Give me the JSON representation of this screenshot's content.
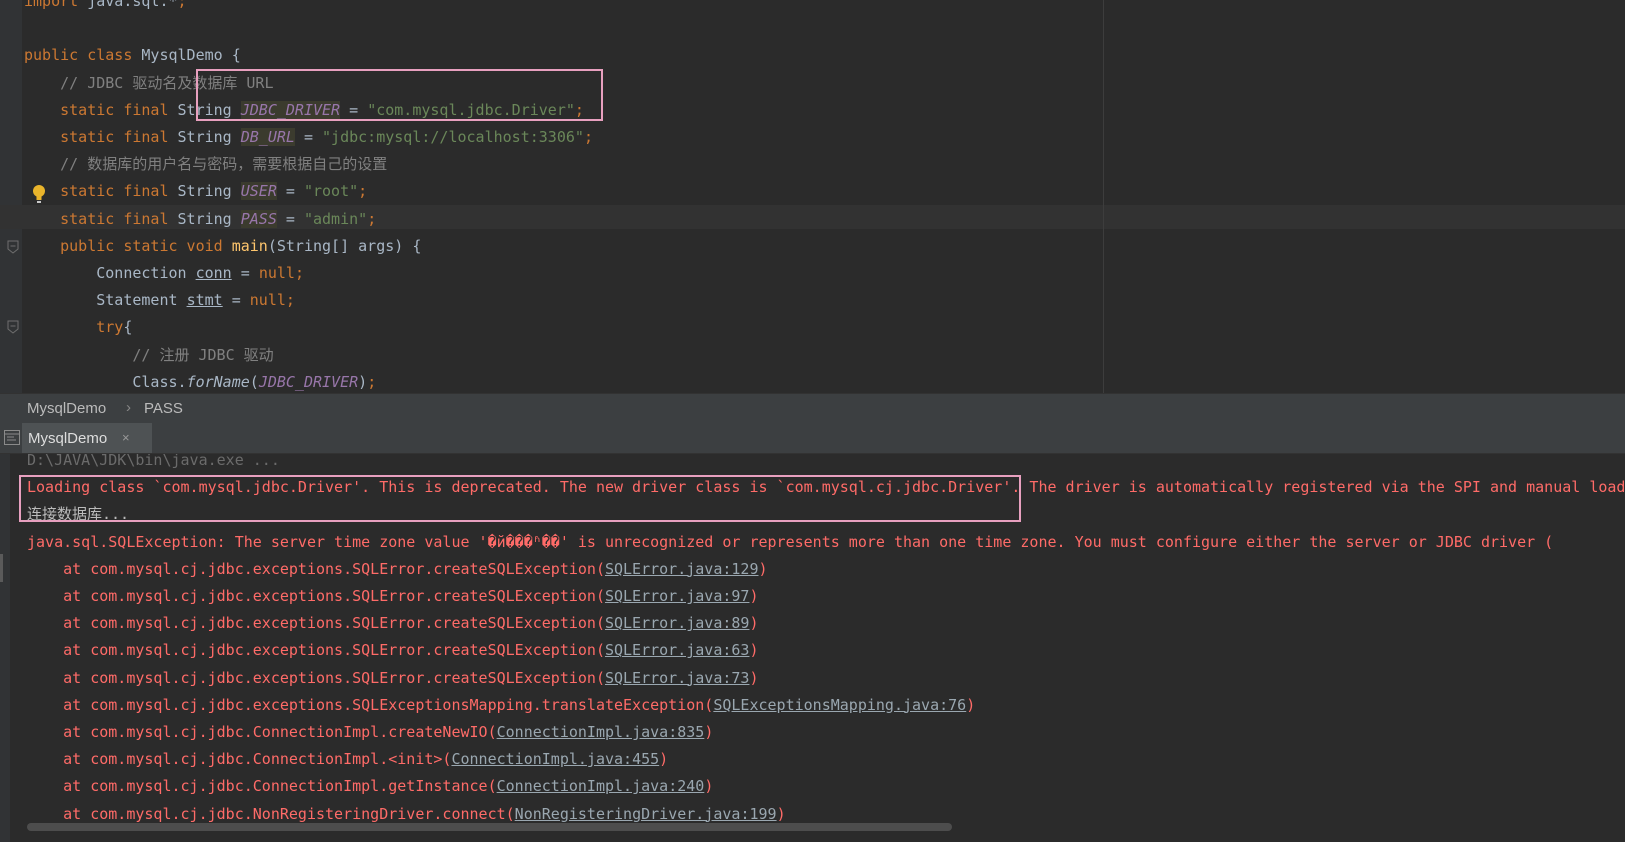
{
  "editor": {
    "lines": [
      {
        "segments": [
          {
            "t": "import ",
            "c": "kw"
          },
          {
            "t": "java.sql.*",
            "c": ""
          },
          {
            "t": ";",
            "c": "kw"
          }
        ]
      },
      {
        "segments": [
          {
            "t": "",
            "c": ""
          }
        ]
      },
      {
        "segments": [
          {
            "t": "public class ",
            "c": "kw"
          },
          {
            "t": "MysqlDemo {",
            "c": ""
          }
        ]
      },
      {
        "segments": [
          {
            "t": "    // JDBC 驱动名及数据库 URL",
            "c": "cm"
          }
        ]
      },
      {
        "segments": [
          {
            "t": "    static final ",
            "c": "kw"
          },
          {
            "t": "String ",
            "c": ""
          },
          {
            "t": "JDBC_DRIVER",
            "c": "cst hl"
          },
          {
            "t": " = ",
            "c": ""
          },
          {
            "t": "\"com.mysql.jdbc.Driver\"",
            "c": "str"
          },
          {
            "t": ";",
            "c": "kw"
          }
        ]
      },
      {
        "segments": [
          {
            "t": "    static final ",
            "c": "kw"
          },
          {
            "t": "String ",
            "c": ""
          },
          {
            "t": "DB_URL",
            "c": "cst hl"
          },
          {
            "t": " = ",
            "c": ""
          },
          {
            "t": "\"jdbc:mysql://localhost:3306\"",
            "c": "str"
          },
          {
            "t": ";",
            "c": "kw"
          }
        ]
      },
      {
        "segments": [
          {
            "t": "    // 数据库的用户名与密码，需要根据自己的设置",
            "c": "cm"
          }
        ]
      },
      {
        "segments": [
          {
            "t": "    static final ",
            "c": "kw"
          },
          {
            "t": "String ",
            "c": ""
          },
          {
            "t": "USER",
            "c": "cst hl"
          },
          {
            "t": " = ",
            "c": ""
          },
          {
            "t": "\"root\"",
            "c": "str"
          },
          {
            "t": ";",
            "c": "kw"
          }
        ]
      },
      {
        "segments": [
          {
            "t": "    static final ",
            "c": "kw"
          },
          {
            "t": "String ",
            "c": ""
          },
          {
            "t": "PASS",
            "c": "cst hl"
          },
          {
            "t": " = ",
            "c": ""
          },
          {
            "t": "\"admin\"",
            "c": "str"
          },
          {
            "t": ";",
            "c": "kw"
          }
        ]
      },
      {
        "segments": [
          {
            "t": "    public static void ",
            "c": "kw"
          },
          {
            "t": "main",
            "c": "fn"
          },
          {
            "t": "(String[] args) {",
            "c": ""
          }
        ]
      },
      {
        "segments": [
          {
            "t": "        Connection ",
            "c": ""
          },
          {
            "t": "conn",
            "c": "ul"
          },
          {
            "t": " = ",
            "c": ""
          },
          {
            "t": "null",
            "c": "kw"
          },
          {
            "t": ";",
            "c": "kw"
          }
        ]
      },
      {
        "segments": [
          {
            "t": "        Statement ",
            "c": ""
          },
          {
            "t": "stmt",
            "c": "ul"
          },
          {
            "t": " = ",
            "c": ""
          },
          {
            "t": "null",
            "c": "kw"
          },
          {
            "t": ";",
            "c": "kw"
          }
        ]
      },
      {
        "segments": [
          {
            "t": "        try",
            "c": "kw"
          },
          {
            "t": "{",
            "c": ""
          }
        ]
      },
      {
        "segments": [
          {
            "t": "            // 注册 JDBC 驱动",
            "c": "cm"
          }
        ]
      },
      {
        "segments": [
          {
            "t": "            Class.",
            "c": ""
          },
          {
            "t": "forName",
            "c": "it"
          },
          {
            "t": "(",
            "c": ""
          },
          {
            "t": "JDBC_DRIVER",
            "c": "cst"
          },
          {
            "t": ")",
            "c": ""
          },
          {
            "t": ";",
            "c": "kw"
          }
        ]
      }
    ]
  },
  "breadcrumb": {
    "items": [
      "MysqlDemo",
      "PASS"
    ],
    "separator": "›"
  },
  "run_tab": {
    "label": "MysqlDemo",
    "close": "×"
  },
  "console": {
    "lines": [
      {
        "segments": [
          {
            "t": "D:\\JAVA\\JDK\\bin\\java.exe ...",
            "c": "dim"
          }
        ]
      },
      {
        "segments": [
          {
            "t": "Loading class `com.mysql.jdbc.Driver'. This is deprecated. The new driver class is `com.mysql.cj.jdbc.Driver'. The driver is automatically registered via the SPI and manual loading",
            "c": "err"
          }
        ]
      },
      {
        "segments": [
          {
            "t": "连接数据库...",
            "c": "norm"
          }
        ]
      },
      {
        "segments": [
          {
            "t": "java.sql.SQLException: The server time zone value '�й���ʱ��' is unrecognized or represents more than one time zone. You must configure either the server or JDBC driver (",
            "c": "err"
          }
        ]
      },
      {
        "segments": [
          {
            "t": "    at com.mysql.cj.jdbc.exceptions.SQLError.createSQLException(",
            "c": "err"
          },
          {
            "t": "SQLError.java:129",
            "c": "link"
          },
          {
            "t": ")",
            "c": "err"
          }
        ]
      },
      {
        "segments": [
          {
            "t": "    at com.mysql.cj.jdbc.exceptions.SQLError.createSQLException(",
            "c": "err"
          },
          {
            "t": "SQLError.java:97",
            "c": "link"
          },
          {
            "t": ")",
            "c": "err"
          }
        ]
      },
      {
        "segments": [
          {
            "t": "    at com.mysql.cj.jdbc.exceptions.SQLError.createSQLException(",
            "c": "err"
          },
          {
            "t": "SQLError.java:89",
            "c": "link"
          },
          {
            "t": ")",
            "c": "err"
          }
        ]
      },
      {
        "segments": [
          {
            "t": "    at com.mysql.cj.jdbc.exceptions.SQLError.createSQLException(",
            "c": "err"
          },
          {
            "t": "SQLError.java:63",
            "c": "link"
          },
          {
            "t": ")",
            "c": "err"
          }
        ]
      },
      {
        "segments": [
          {
            "t": "    at com.mysql.cj.jdbc.exceptions.SQLError.createSQLException(",
            "c": "err"
          },
          {
            "t": "SQLError.java:73",
            "c": "link"
          },
          {
            "t": ")",
            "c": "err"
          }
        ]
      },
      {
        "segments": [
          {
            "t": "    at com.mysql.cj.jdbc.exceptions.SQLExceptionsMapping.translateException(",
            "c": "err"
          },
          {
            "t": "SQLExceptionsMapping.java:76",
            "c": "link"
          },
          {
            "t": ")",
            "c": "err"
          }
        ]
      },
      {
        "segments": [
          {
            "t": "    at com.mysql.cj.jdbc.ConnectionImpl.createNewIO(",
            "c": "err"
          },
          {
            "t": "ConnectionImpl.java:835",
            "c": "link"
          },
          {
            "t": ")",
            "c": "err"
          }
        ]
      },
      {
        "segments": [
          {
            "t": "    at com.mysql.cj.jdbc.ConnectionImpl.<init>(",
            "c": "err"
          },
          {
            "t": "ConnectionImpl.java:455",
            "c": "link"
          },
          {
            "t": ")",
            "c": "err"
          }
        ]
      },
      {
        "segments": [
          {
            "t": "    at com.mysql.cj.jdbc.ConnectionImpl.getInstance(",
            "c": "err"
          },
          {
            "t": "ConnectionImpl.java:240",
            "c": "link"
          },
          {
            "t": ")",
            "c": "err"
          }
        ]
      },
      {
        "segments": [
          {
            "t": "    at com.mysql.cj.jdbc.NonRegisteringDriver.connect(",
            "c": "err"
          },
          {
            "t": "NonRegisteringDriver.java:199",
            "c": "link"
          },
          {
            "t": ")",
            "c": "err"
          }
        ]
      }
    ]
  }
}
